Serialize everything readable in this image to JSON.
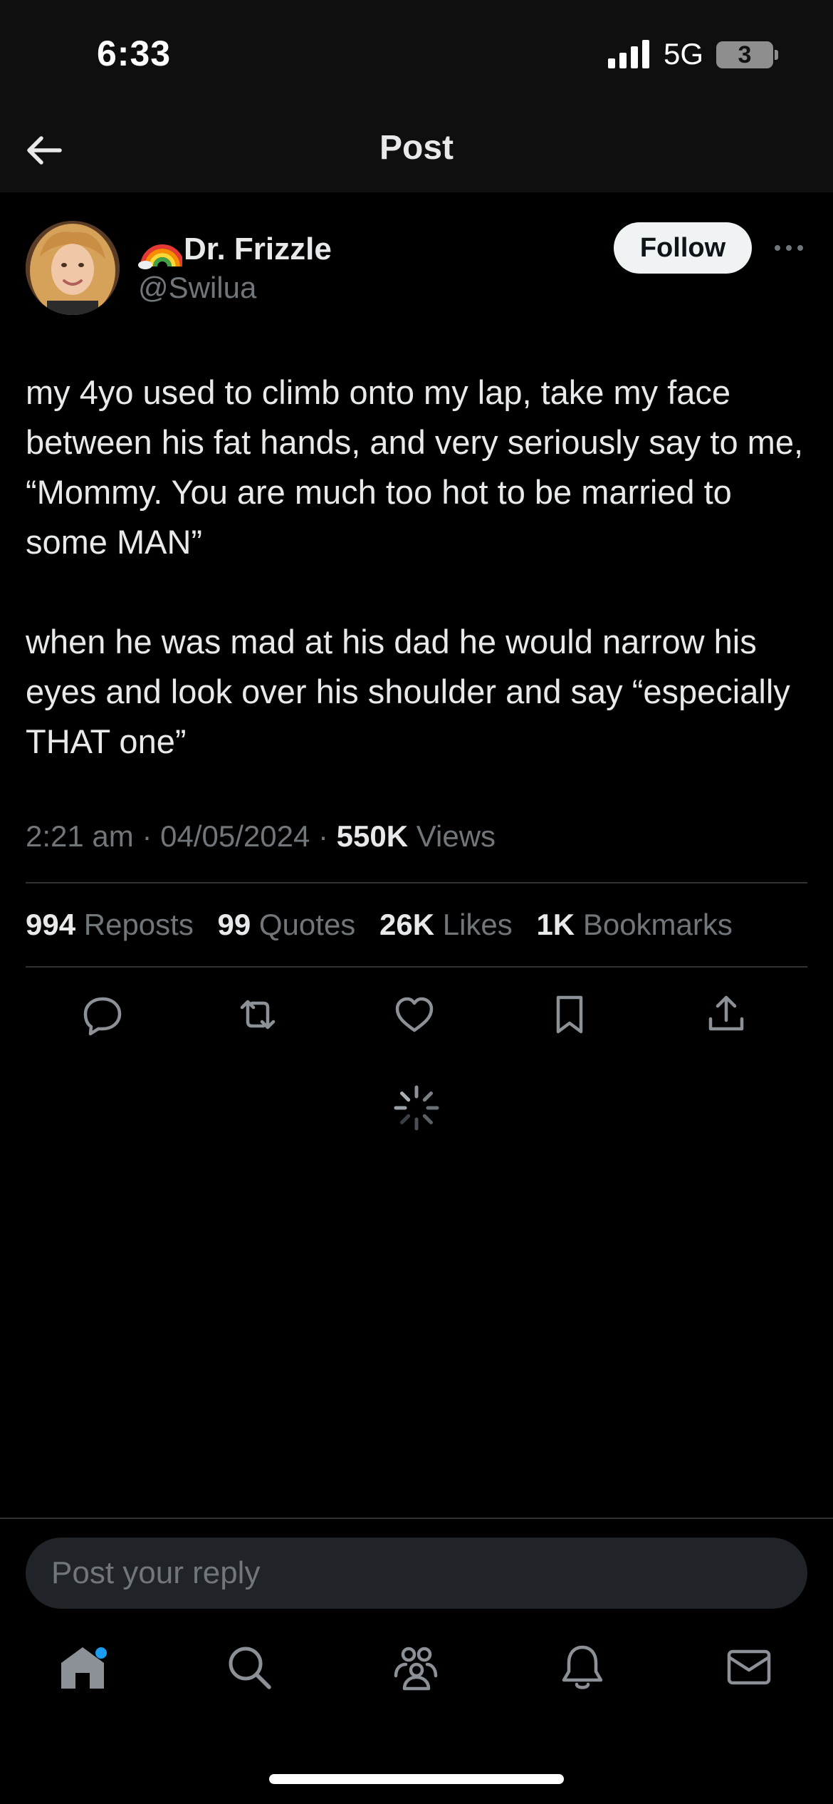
{
  "status_bar": {
    "time": "6:33",
    "network": "5G",
    "battery": "3"
  },
  "nav": {
    "title": "Post",
    "back_icon": "arrow-left-icon"
  },
  "author": {
    "display_name": "Dr. Frizzle",
    "name_emoji": "rainbow-icon",
    "handle": "@Swilua",
    "follow_label": "Follow",
    "more_icon": "ellipsis-icon"
  },
  "post": {
    "paragraph_1": "my 4yo used to climb onto my lap, take my face between his fat hands, and very seriously say to me, “Mommy. You are much too hot to be married to some MAN”",
    "paragraph_2": "when he was mad at his dad he would narrow his eyes and look over his shoulder and say “especially THAT one”"
  },
  "meta": {
    "time": "2:21 am",
    "date": "04/05/2024",
    "separator": "·",
    "views_count": "550K",
    "views_label": "Views"
  },
  "stats": [
    {
      "count": "994",
      "label": "Reposts"
    },
    {
      "count": "99",
      "label": "Quotes"
    },
    {
      "count": "26K",
      "label": "Likes"
    },
    {
      "count": "1K",
      "label": "Bookmarks"
    }
  ],
  "actions": [
    "reply-icon",
    "repost-icon",
    "like-icon",
    "bookmark-icon",
    "share-icon"
  ],
  "reply": {
    "placeholder": "Post your reply"
  },
  "tab_bar": [
    "home-icon",
    "search-icon",
    "communities-icon",
    "notifications-icon",
    "messages-icon"
  ],
  "colors": {
    "background": "#000000",
    "text": "#e7e9ea",
    "muted": "#71767b",
    "divider": "#2f3336",
    "accent": "#1d9bf0"
  }
}
